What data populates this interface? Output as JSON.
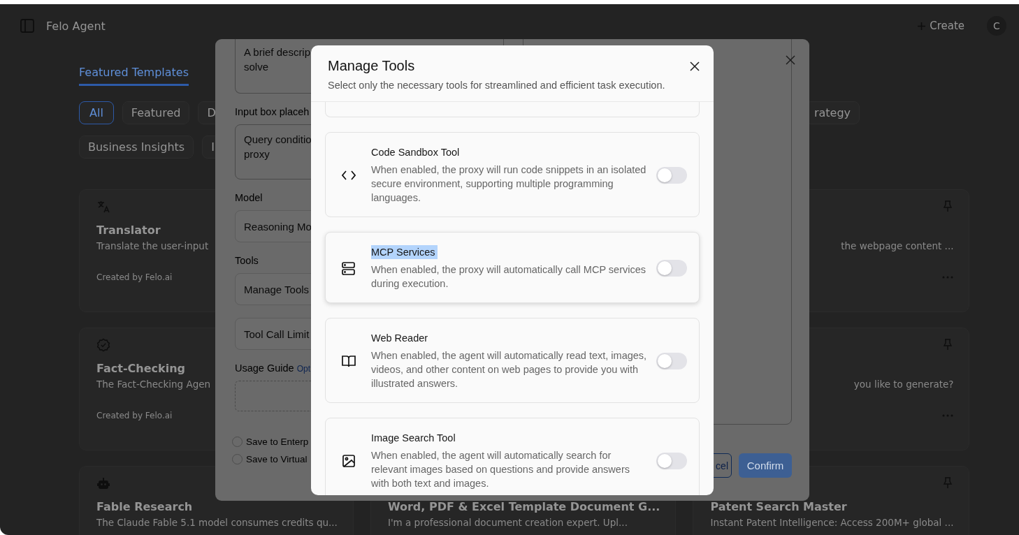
{
  "app": {
    "title": "Felo Agent",
    "create_button": "Create",
    "avatar": "C"
  },
  "tabs": [
    {
      "label": "Featured Templates",
      "selected": true
    }
  ],
  "filter_rows": [
    [
      {
        "label": "All",
        "selected": true
      },
      {
        "label": "Featured",
        "selected": false
      },
      {
        "label": "D",
        "selected": false
      },
      {
        "label": "rategy",
        "selected": false
      }
    ],
    [
      {
        "label": "Business Insights",
        "selected": false
      },
      {
        "label": "I",
        "selected": false
      }
    ]
  ],
  "card_columns": [
    [
      {
        "title": "Translator",
        "description": "Translate the user-input",
        "creator": "Created by Felo.ai"
      },
      {
        "title": "Fact-Checking",
        "description": "The Fact-Checking Agen",
        "creator": "Created by Felo.ai"
      },
      {
        "title": "Fable Research",
        "description": "The Claude Fable 5.1 model consumes credits qu..."
      }
    ],
    [
      {
        "title": "Word, PDF & Excel Template Document G...",
        "description": "I'm a professional document creation expert. Upl..."
      }
    ],
    [
      {
        "covered": true,
        "pin": true,
        "description": "the webpage content ...",
        "more": true
      },
      {
        "covered": true,
        "pin": true,
        "description": "you like to generate?",
        "more": true
      },
      {
        "covered": false,
        "pin": true,
        "title": "Patent Search Master",
        "description": "Instant Patent Intelligence: Access 200M+ global ..."
      }
    ]
  ],
  "create_dialog": {
    "items": [
      {
        "kind": "textarea",
        "lines": [
          "A brief descrip",
          "solve"
        ]
      },
      {
        "kind": "label",
        "text": "Input box placeh"
      },
      {
        "kind": "textarea",
        "lines": [
          "Query conditio",
          "proxy"
        ]
      },
      {
        "kind": "label",
        "text": "Model"
      },
      {
        "kind": "select",
        "value": "Reasoning Mo"
      },
      {
        "kind": "label",
        "text": "Tools"
      },
      {
        "kind": "button",
        "text": "Manage Tools"
      },
      {
        "kind": "button",
        "text": "Tool Call Limit"
      },
      {
        "kind": "label",
        "text": "Usage Guide",
        "hint": "Opt"
      },
      {
        "kind": "upload"
      },
      {
        "kind": "radio",
        "text": "Save to Enterp",
        "checked": false
      },
      {
        "kind": "radio",
        "text": "Save to Virtual",
        "checked": false
      }
    ],
    "cancel_button": "cel",
    "confirm_button": "Confirm"
  },
  "manage_tools": {
    "title": "Manage Tools",
    "subtitle": "Select only the necessary tools for streamlined and efficient task execution.",
    "tools": [
      {
        "name": "Code Sandbox Tool",
        "description": "When enabled, the proxy will run code snippets in an isolated secure environment, supporting multiple programming languages.",
        "on": false,
        "hovered": false,
        "text_selected": false
      },
      {
        "name": "MCP Services",
        "description": "When enabled, the proxy will automatically call MCP services during execution.",
        "on": false,
        "hovered": true,
        "text_selected": true
      },
      {
        "name": "Web Reader",
        "description": "When enabled, the agent will automatically read text, images, videos, and other content on web pages to provide you with illustrated answers.",
        "on": false,
        "hovered": false,
        "text_selected": false
      },
      {
        "name": "Image Search Tool",
        "description": "When enabled, the agent will automatically search for relevant images based on questions and provide answers with both text and images.",
        "on": false,
        "hovered": false,
        "text_selected": false
      }
    ]
  }
}
